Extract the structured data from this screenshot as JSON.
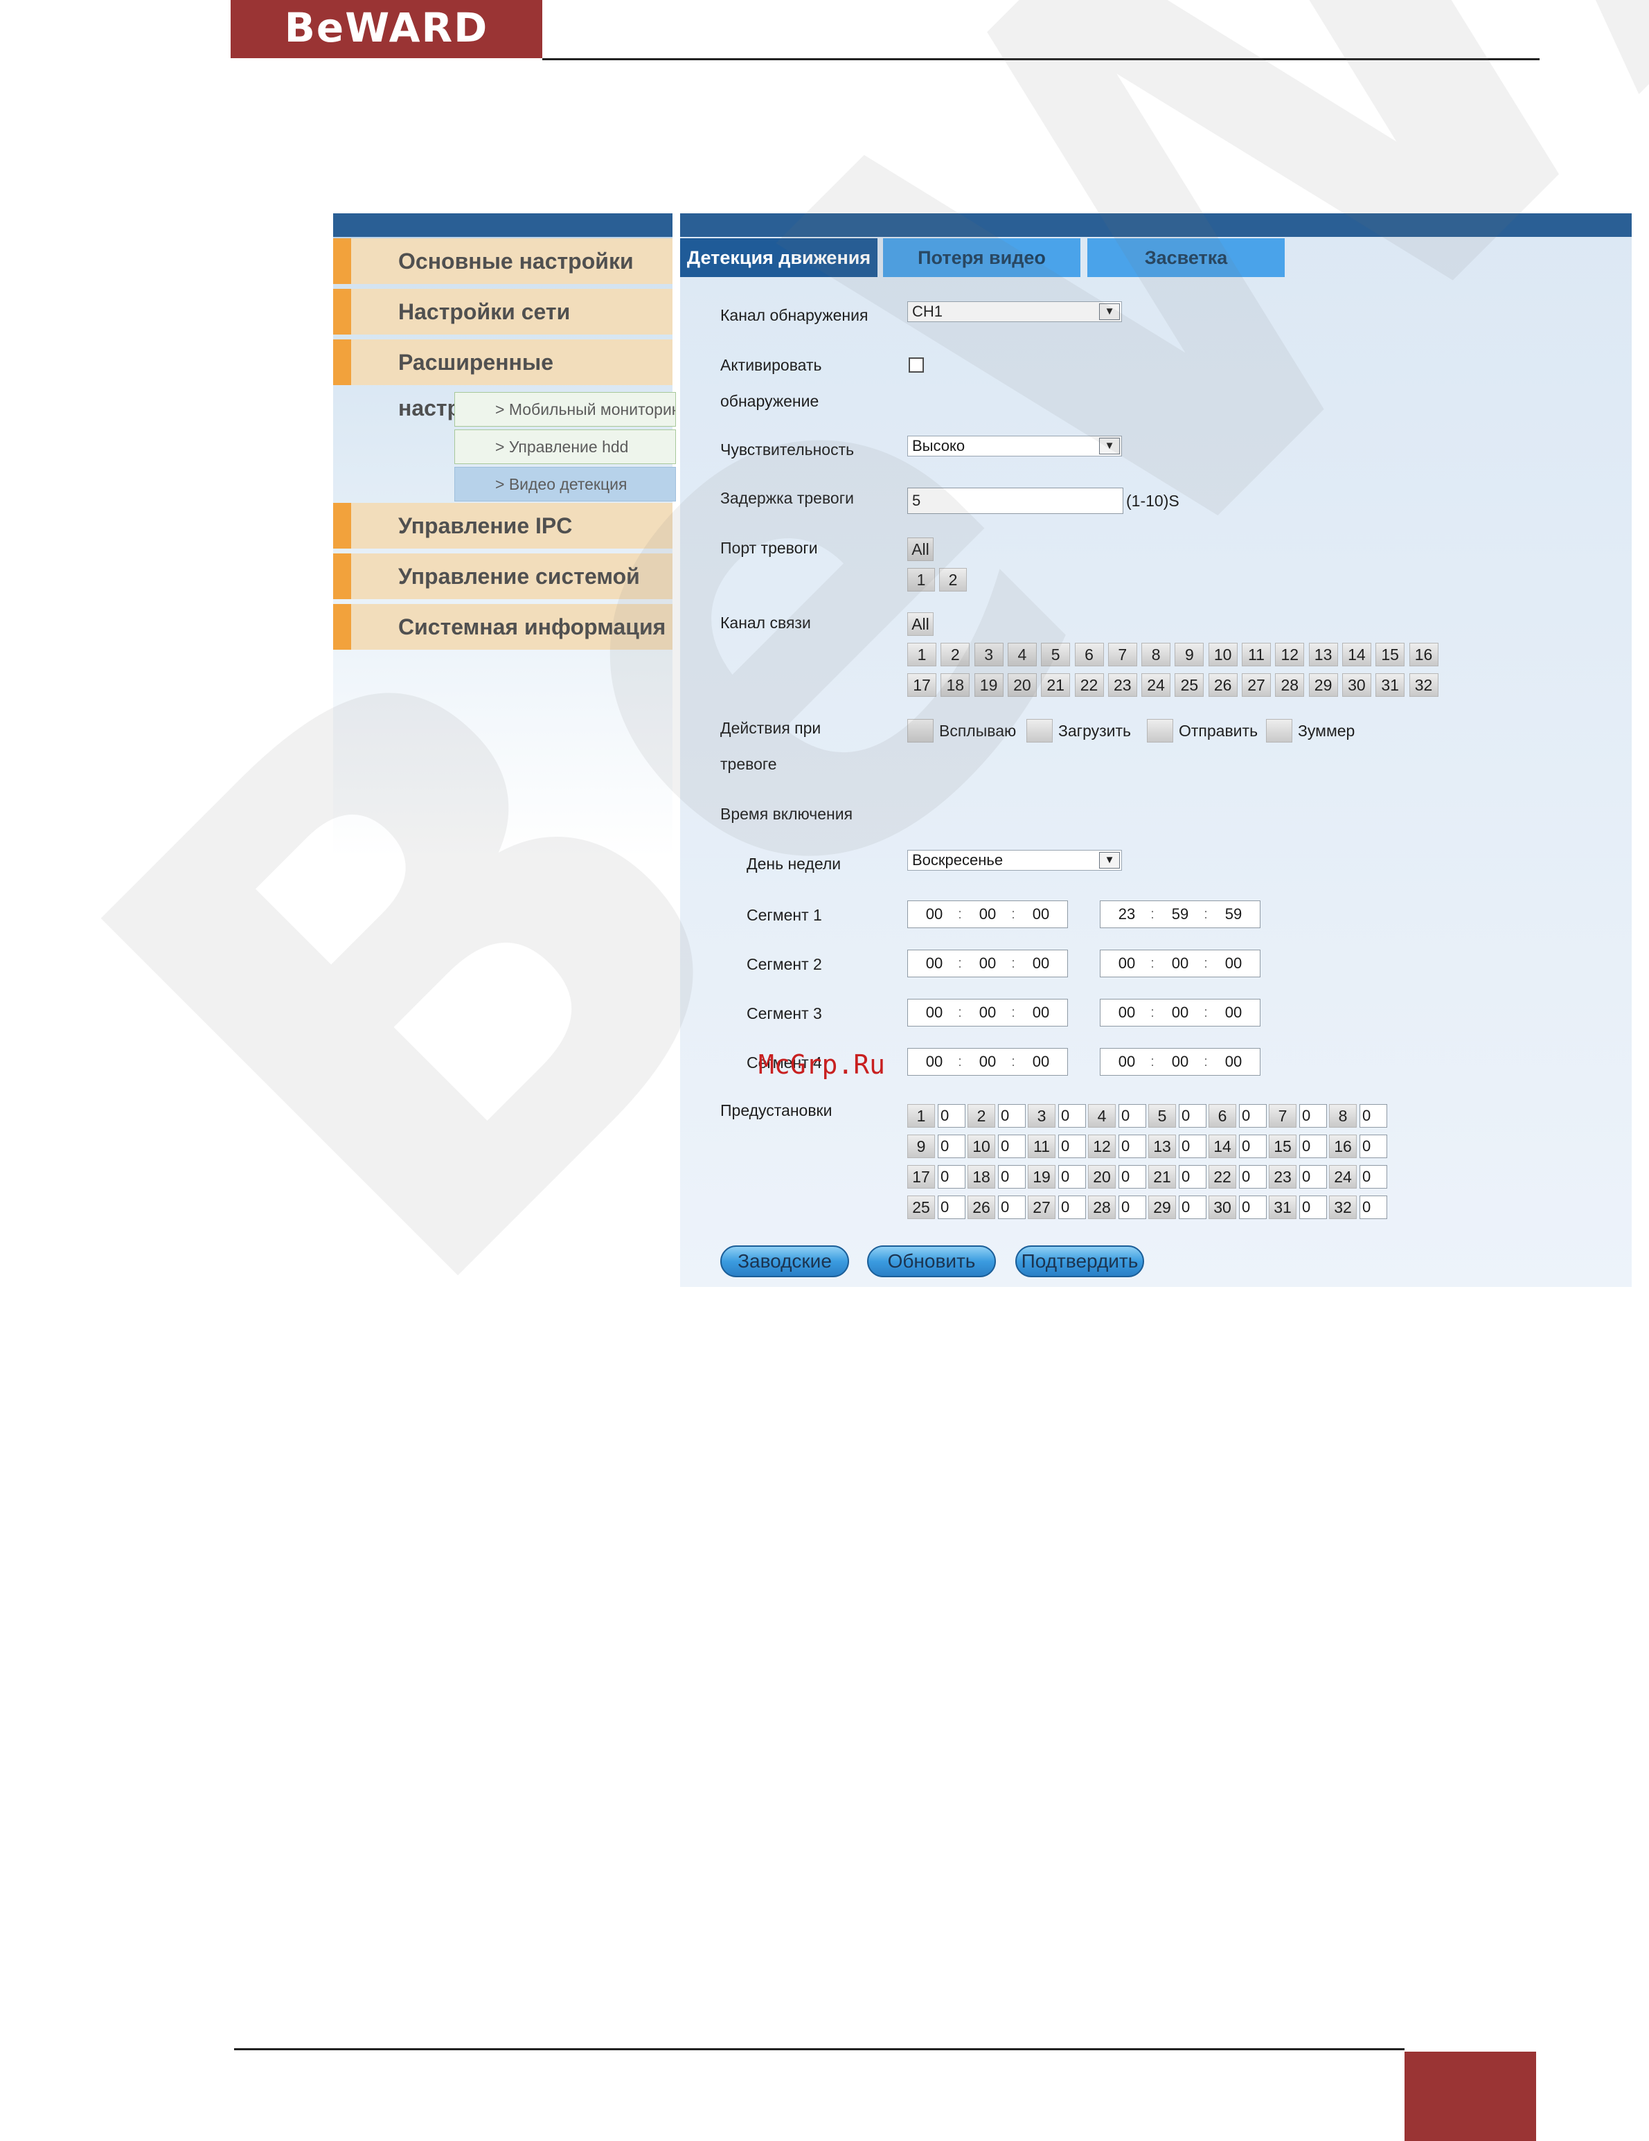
{
  "brand": {
    "logo_text": "BeWARD"
  },
  "watermark_text": "BeWARD",
  "site_watermark": "McGrp.Ru",
  "sidebar": {
    "items": [
      {
        "label": "Основные настройки"
      },
      {
        "label": "Настройки сети"
      },
      {
        "label": "Расширенные настройки"
      },
      {
        "label": "Управление IPC"
      },
      {
        "label": "Управление системой"
      },
      {
        "label": "Системная информация"
      }
    ],
    "subitems": [
      {
        "label": "> Мобильный мониторинг"
      },
      {
        "label": "> Управление hdd"
      },
      {
        "label": "> Видео детекция",
        "active": true
      }
    ]
  },
  "tabs": [
    {
      "label": "Детекция движения",
      "active": true
    },
    {
      "label": "Потеря видео"
    },
    {
      "label": "Засветка"
    }
  ],
  "form": {
    "channel": {
      "label": "Канал обнаружения",
      "value": "CH1"
    },
    "activate": {
      "label_line1": "Активировать",
      "label_line2": "обнаружение",
      "checked": false
    },
    "sensitivity": {
      "label": "Чувствительность",
      "value": "Высоко"
    },
    "alarm_delay": {
      "label": "Задержка тревоги",
      "value": "5",
      "unit": "(1-10)S"
    },
    "alarm_port": {
      "label": "Порт тревоги",
      "all": "All",
      "ports": [
        "1",
        "2"
      ]
    },
    "link_channel": {
      "label": "Канал связи",
      "all": "All",
      "channels": [
        "1",
        "2",
        "3",
        "4",
        "5",
        "6",
        "7",
        "8",
        "9",
        "10",
        "11",
        "12",
        "13",
        "14",
        "15",
        "16",
        "17",
        "18",
        "19",
        "20",
        "21",
        "22",
        "23",
        "24",
        "25",
        "26",
        "27",
        "28",
        "29",
        "30",
        "31",
        "32"
      ]
    },
    "alarm_actions": {
      "label_line1": "Действия при",
      "label_line2": "тревоге",
      "options": [
        "Всплываю",
        "Загрузить",
        "Отправить",
        "Зуммер"
      ]
    },
    "schedule": {
      "label": "Время включения",
      "day_label": "День недели",
      "day_value": "Воскресенье",
      "segments": [
        {
          "label": "Сегмент 1",
          "start": [
            "00",
            "00",
            "00"
          ],
          "end": [
            "23",
            "59",
            "59"
          ]
        },
        {
          "label": "Сегмент 2",
          "start": [
            "00",
            "00",
            "00"
          ],
          "end": [
            "00",
            "00",
            "00"
          ]
        },
        {
          "label": "Сегмент 3",
          "start": [
            "00",
            "00",
            "00"
          ],
          "end": [
            "00",
            "00",
            "00"
          ]
        },
        {
          "label": "Сегмент 4",
          "start": [
            "00",
            "00",
            "00"
          ],
          "end": [
            "00",
            "00",
            "00"
          ]
        }
      ]
    },
    "presets": {
      "label": "Предустановки",
      "items": [
        {
          "n": "1",
          "v": "0"
        },
        {
          "n": "2",
          "v": "0"
        },
        {
          "n": "3",
          "v": "0"
        },
        {
          "n": "4",
          "v": "0"
        },
        {
          "n": "5",
          "v": "0"
        },
        {
          "n": "6",
          "v": "0"
        },
        {
          "n": "7",
          "v": "0"
        },
        {
          "n": "8",
          "v": "0"
        },
        {
          "n": "9",
          "v": "0"
        },
        {
          "n": "10",
          "v": "0"
        },
        {
          "n": "11",
          "v": "0"
        },
        {
          "n": "12",
          "v": "0"
        },
        {
          "n": "13",
          "v": "0"
        },
        {
          "n": "14",
          "v": "0"
        },
        {
          "n": "15",
          "v": "0"
        },
        {
          "n": "16",
          "v": "0"
        },
        {
          "n": "17",
          "v": "0"
        },
        {
          "n": "18",
          "v": "0"
        },
        {
          "n": "19",
          "v": "0"
        },
        {
          "n": "20",
          "v": "0"
        },
        {
          "n": "21",
          "v": "0"
        },
        {
          "n": "22",
          "v": "0"
        },
        {
          "n": "23",
          "v": "0"
        },
        {
          "n": "24",
          "v": "0"
        },
        {
          "n": "25",
          "v": "0"
        },
        {
          "n": "26",
          "v": "0"
        },
        {
          "n": "27",
          "v": "0"
        },
        {
          "n": "28",
          "v": "0"
        },
        {
          "n": "29",
          "v": "0"
        },
        {
          "n": "30",
          "v": "0"
        },
        {
          "n": "31",
          "v": "0"
        },
        {
          "n": "32",
          "v": "0"
        }
      ]
    }
  },
  "buttons": {
    "defaults": "Заводские",
    "refresh": "Обновить",
    "confirm": "Подтвердить"
  },
  "colors": {
    "brand": "#9a3434",
    "accent_orange": "#f2a23c",
    "tab_active": "#1f5b98",
    "tab_inactive": "#4aa3ea"
  }
}
